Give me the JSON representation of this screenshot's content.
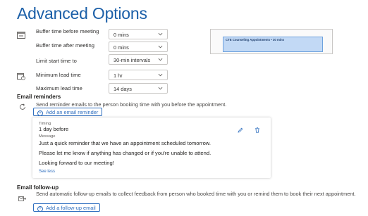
{
  "page": {
    "title": "Advanced Options"
  },
  "scheduling": {
    "rows": [
      {
        "label": "Buffer time before meeting",
        "value": "0 mins"
      },
      {
        "label": "Buffer time after meeting",
        "value": "0 mins"
      },
      {
        "label": "Limit start time to",
        "value": "30-min intervals"
      },
      {
        "label": "Minimum lead time",
        "value": "1 hr"
      },
      {
        "label": "Maximum lead time",
        "value": "14 days"
      }
    ],
    "buffer_icon": "calendar-buffer-icon",
    "lead_time_icon": "calendar-clock-icon",
    "dropdown_icon": "chevron-down-icon"
  },
  "preview": {
    "appointment_text": "CTE Counseling Appointments • 30 mins"
  },
  "email_reminders": {
    "heading": "Email reminders",
    "description": "Send reminder emails to the person booking time with you before the appointment.",
    "add_button": "Add an email reminder",
    "card": {
      "timing_label": "Timing",
      "timing_value": "1 day before",
      "message_label": "Message",
      "message_lines": [
        "Just a quick reminder that we have an appointment scheduled tomorrow.",
        "Please let me know if anything has changed or if you're unable to attend.",
        "Looking forward to our meeting!"
      ],
      "see_less": "See less",
      "edit_icon": "pencil-icon",
      "delete_icon": "trash-icon"
    }
  },
  "email_followup": {
    "heading": "Email follow-up",
    "description": "Send automatic follow-up emails to collect feedback from person who booked time with you or remind them to book their next appointment.",
    "add_button": "Add a follow-up email"
  },
  "colors": {
    "title": "#1b5fa8",
    "accent": "#2f6fbf",
    "preview_block": "#c2d9f5"
  }
}
